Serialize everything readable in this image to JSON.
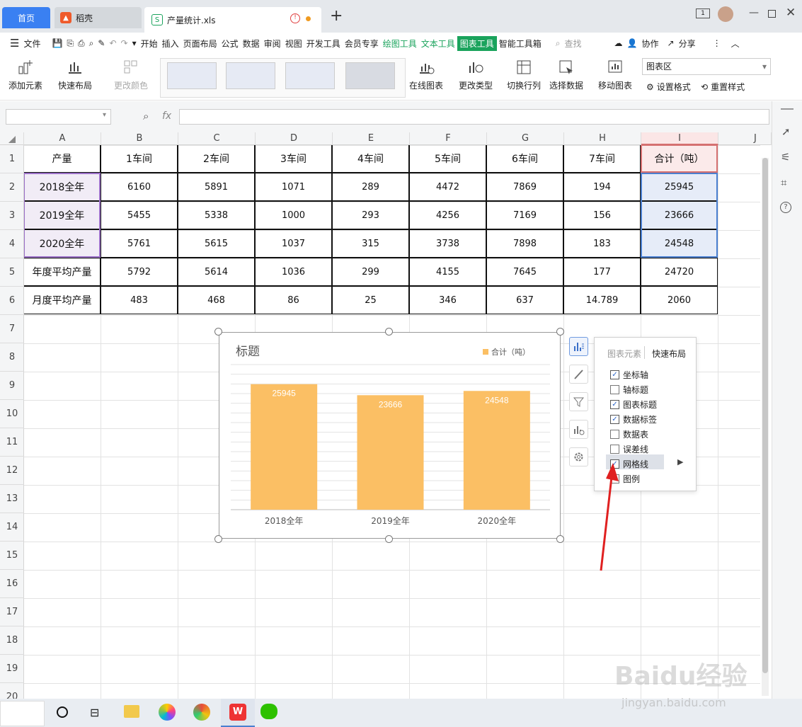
{
  "tabs": {
    "home": "首页",
    "daoke": "稻壳",
    "file": "产量统计.xls",
    "new_tab": "+"
  },
  "menu": {
    "file": "文件",
    "items": [
      "开始",
      "插入",
      "页面布局",
      "公式",
      "数据",
      "审阅",
      "视图",
      "开发工具",
      "会员专享",
      "绘图工具",
      "文本工具",
      "图表工具",
      "智能工具箱"
    ],
    "search": "查找",
    "collab": "协作",
    "share": "分享"
  },
  "ribbon": {
    "add_element": "添加元素",
    "quick_layout": "快速布局",
    "change_color": "更改颜色",
    "online_chart": "在线图表",
    "change_type": "更改类型",
    "switch_row_col": "切换行列",
    "select_data": "选择数据",
    "move_chart": "移动图表",
    "chart_area": "图表区",
    "set_format": "设置格式",
    "reset_style": "重置样式"
  },
  "formula": {
    "fx": "fx",
    "name_box": "",
    "content": ""
  },
  "columns": [
    "A",
    "B",
    "C",
    "D",
    "E",
    "F",
    "G",
    "H",
    "I",
    "J"
  ],
  "rows": [
    "1",
    "2",
    "3",
    "4",
    "5",
    "6",
    "7",
    "8",
    "9",
    "10",
    "11",
    "12",
    "13",
    "14",
    "15",
    "16",
    "17",
    "18",
    "19",
    "20"
  ],
  "table": [
    [
      "产量",
      "1车间",
      "2车间",
      "3车间",
      "4车间",
      "5车间",
      "6车间",
      "7车间",
      "合计（吨）"
    ],
    [
      "2018全年",
      "6160",
      "5891",
      "1071",
      "289",
      "4472",
      "7869",
      "194",
      "25945"
    ],
    [
      "2019全年",
      "5455",
      "5338",
      "1000",
      "293",
      "4256",
      "7169",
      "156",
      "23666"
    ],
    [
      "2020全年",
      "5761",
      "5615",
      "1037",
      "315",
      "3738",
      "7898",
      "183",
      "24548"
    ],
    [
      "年度平均产量",
      "5792",
      "5614",
      "1036",
      "299",
      "4155",
      "7645",
      "177",
      "24720"
    ],
    [
      "月度平均产量",
      "483",
      "468",
      "86",
      "25",
      "346",
      "637",
      "14.789",
      "2060"
    ]
  ],
  "chart_data": {
    "type": "bar",
    "title": "标题",
    "categories": [
      "2018全年",
      "2019全年",
      "2020全年"
    ],
    "series": [
      {
        "name": "合计（吨）",
        "values": [
          25945,
          23666,
          24548
        ]
      }
    ],
    "ylim": [
      0,
      30000
    ],
    "grid": true,
    "legend": "top-right",
    "color": "#fbbf64"
  },
  "panel": {
    "tab_elements": "图表元素",
    "tab_layout": "快速布局",
    "items": [
      {
        "label": "坐标轴",
        "checked": true
      },
      {
        "label": "轴标题",
        "checked": false
      },
      {
        "label": "图表标题",
        "checked": true
      },
      {
        "label": "数据标签",
        "checked": true
      },
      {
        "label": "数据表",
        "checked": false
      },
      {
        "label": "误差线",
        "checked": false
      },
      {
        "label": "网格线",
        "checked": true
      },
      {
        "label": "图例",
        "checked": false
      }
    ]
  },
  "watermark": {
    "brand": "Baidu经验",
    "url": "jingyan.baidu.com"
  },
  "colors": {
    "accent": "#3a80f2",
    "chart_tab": "#1aa35c",
    "bar": "#fbbf64",
    "arrow": "#e02020"
  }
}
